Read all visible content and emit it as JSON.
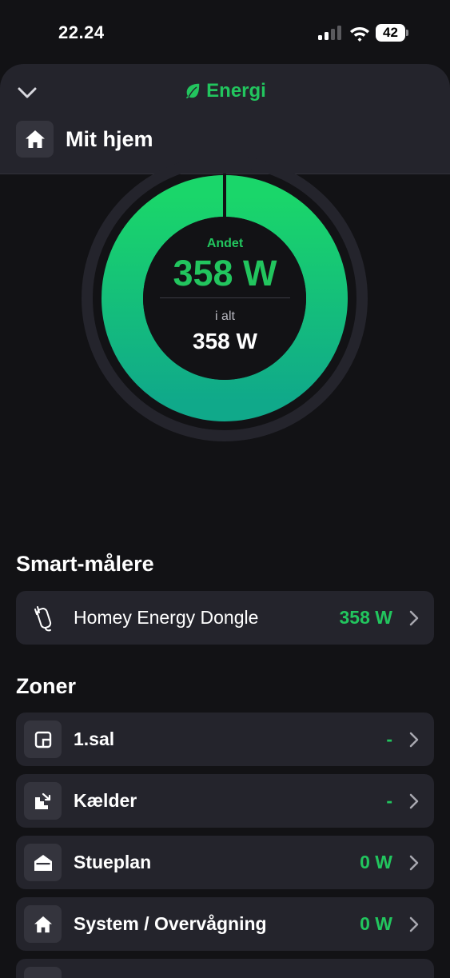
{
  "status_bar": {
    "time": "22.24",
    "battery": "42"
  },
  "header": {
    "title": "Energi",
    "home_title": "Mit hjem"
  },
  "donut": {
    "other_label": "Andet",
    "other_value": "358 W",
    "total_label": "i alt",
    "total_value": "358 W"
  },
  "colors": {
    "accent": "#22c55e",
    "background": "#121215",
    "card": "#24242c",
    "icon_box": "#34343d"
  },
  "smart_meters": {
    "title": "Smart-målere",
    "items": [
      {
        "label": "Homey Energy Dongle",
        "value": "358 W",
        "icon": "energy-dongle-icon"
      }
    ]
  },
  "zones": {
    "title": "Zoner",
    "items": [
      {
        "label": "1.sal",
        "value": "-",
        "icon": "floor-plan-icon"
      },
      {
        "label": "Kælder",
        "value": "-",
        "icon": "stairs-down-icon"
      },
      {
        "label": "Stueplan",
        "value": "0 W",
        "icon": "house-ground-icon"
      },
      {
        "label": "System / Overvågning",
        "value": "0 W",
        "icon": "home-icon"
      }
    ]
  }
}
